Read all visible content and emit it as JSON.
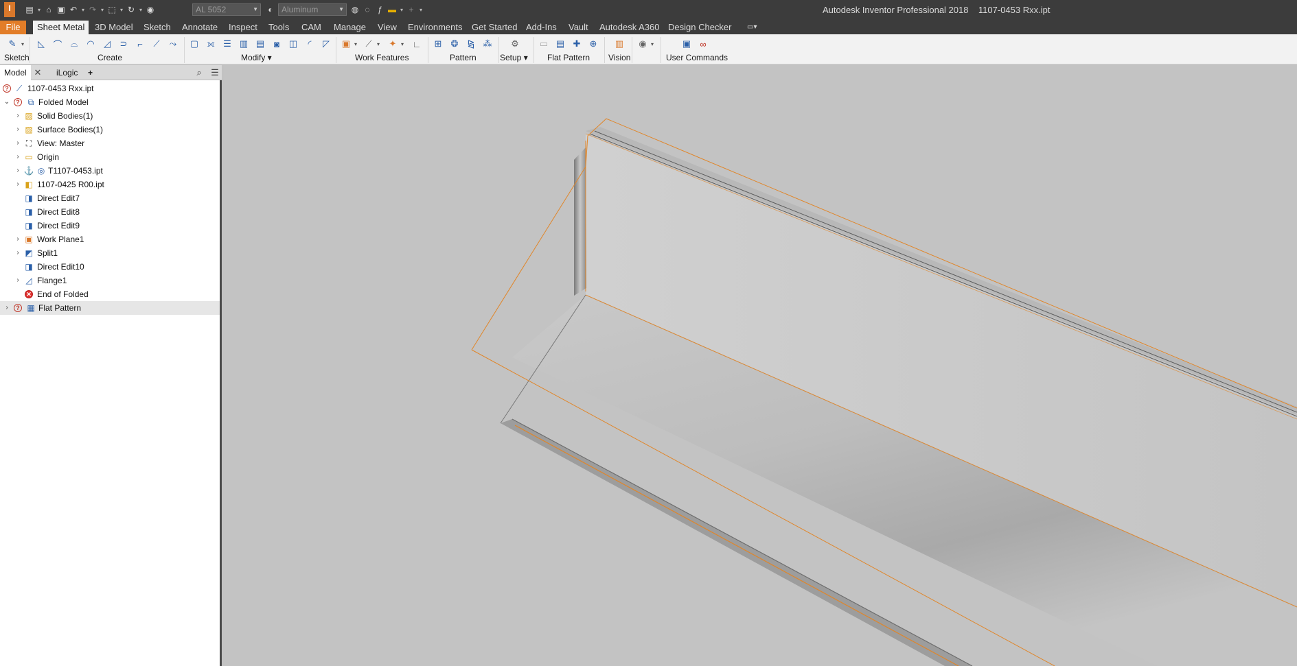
{
  "titlebar": {
    "app_logo": "I",
    "material": "AL 5052",
    "appearance": "Aluminum",
    "title": "Autodesk Inventor Professional 2018    1107-0453 Rxx.ipt"
  },
  "tabs": [
    {
      "label": "File"
    },
    {
      "label": "Sheet Metal"
    },
    {
      "label": "3D Model"
    },
    {
      "label": "Sketch"
    },
    {
      "label": "Annotate"
    },
    {
      "label": "Inspect"
    },
    {
      "label": "Tools"
    },
    {
      "label": "CAM"
    },
    {
      "label": "Manage"
    },
    {
      "label": "View"
    },
    {
      "label": "Environments"
    },
    {
      "label": "Get Started"
    },
    {
      "label": "Add-Ins"
    },
    {
      "label": "Vault"
    },
    {
      "label": "Autodesk A360"
    },
    {
      "label": "Design Checker"
    }
  ],
  "ribbon": {
    "groups": [
      {
        "label": "Sketch"
      },
      {
        "label": "Create"
      },
      {
        "label": "Modify ▾"
      },
      {
        "label": "Work Features"
      },
      {
        "label": "Pattern"
      },
      {
        "label": "Setup ▾"
      },
      {
        "label": "Flat Pattern"
      },
      {
        "label": "Vision"
      },
      {
        "label": "User Commands"
      }
    ]
  },
  "browser": {
    "tabs": [
      {
        "label": "Model"
      },
      {
        "label": "iLogic"
      },
      {
        "label": "+"
      }
    ],
    "tree": [
      {
        "label": "1107-0453 Rxx.ipt"
      },
      {
        "label": "Folded Model"
      },
      {
        "label": "Solid Bodies(1)"
      },
      {
        "label": "Surface Bodies(1)"
      },
      {
        "label": "View: Master"
      },
      {
        "label": "Origin"
      },
      {
        "label": "T1107-0453.ipt"
      },
      {
        "label": "1107-0425 R00.ipt"
      },
      {
        "label": "Direct Edit7"
      },
      {
        "label": "Direct Edit8"
      },
      {
        "label": "Direct Edit9"
      },
      {
        "label": "Work Plane1"
      },
      {
        "label": "Split1"
      },
      {
        "label": "Direct Edit10"
      },
      {
        "label": "Flange1"
      },
      {
        "label": "End of Folded"
      },
      {
        "label": "Flat Pattern"
      }
    ]
  },
  "colors": {
    "accent": "#e27d28",
    "titlebar": "#3c3c3c",
    "viewport": "#c3c3c3",
    "highlight": "#e0862a"
  }
}
